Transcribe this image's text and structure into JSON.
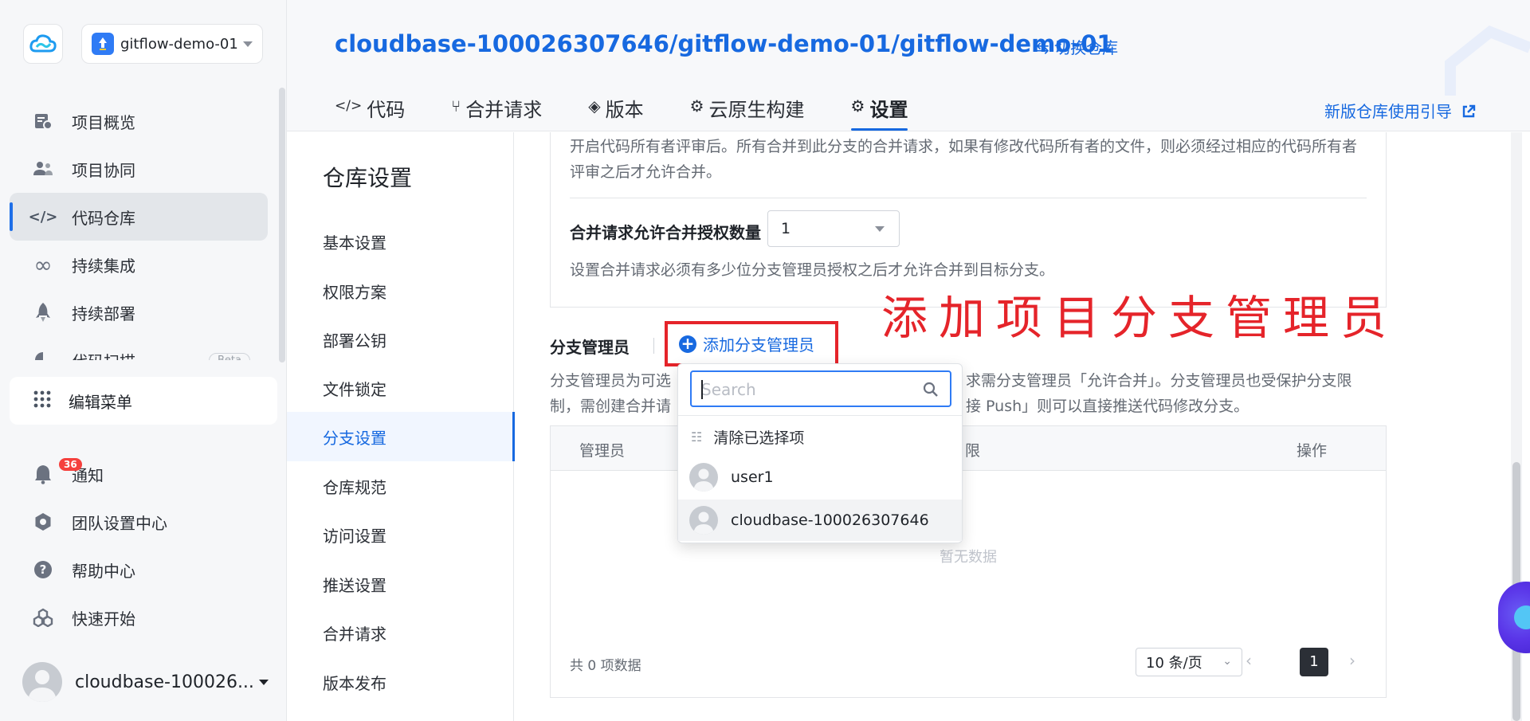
{
  "sidebar": {
    "project_selector": "gitflow-demo-01",
    "items": [
      {
        "label": "项目概览",
        "icon": "dashboard-icon"
      },
      {
        "label": "项目协同",
        "icon": "users-icon"
      },
      {
        "label": "代码仓库",
        "icon": "code-icon",
        "active": true
      },
      {
        "label": "持续集成",
        "icon": "infinity-icon"
      },
      {
        "label": "持续部署",
        "icon": "rocket-icon"
      },
      {
        "label": "代码扫描",
        "icon": "scan-icon",
        "badge": "Beta"
      }
    ],
    "edit_menu": "编辑菜单",
    "bottom_items": [
      {
        "label": "通知",
        "icon": "bell-icon",
        "count": "36"
      },
      {
        "label": "团队设置中心",
        "icon": "settings-icon"
      },
      {
        "label": "帮助中心",
        "icon": "help-icon"
      },
      {
        "label": "快速开始",
        "icon": "cubes-icon"
      }
    ],
    "user_name": "cloudbase-100026..."
  },
  "header": {
    "breadcrumb": "cloudbase-100026307646/gitflow-demo-01/gitflow-demo-01",
    "switch_repo": "⇆ 切换仓库",
    "tabs": [
      {
        "label": "代码",
        "icon": "</>"
      },
      {
        "label": "合并请求",
        "icon": "⑂"
      },
      {
        "label": "版本",
        "icon": "◈"
      },
      {
        "label": "云原生构建",
        "icon": "⚙"
      },
      {
        "label": "设置",
        "icon": "⚙",
        "active": true
      }
    ],
    "guide_link": "新版仓库使用引导"
  },
  "subnav": {
    "title": "仓库设置",
    "items": [
      "基本设置",
      "权限方案",
      "部署公钥",
      "文件锁定",
      "分支设置",
      "仓库规范",
      "访问设置",
      "推送设置",
      "合并请求",
      "版本发布"
    ],
    "active_index": 4
  },
  "main": {
    "code_owner_desc": "开启代码所有者评审后。所有合并到此分支的合并请求，如果有修改代码所有者的文件，则必须经过相应的代码所有者评审之后才允许合并。",
    "merge_auth_label": "合并请求允许合并授权数量",
    "merge_auth_value": "1",
    "merge_auth_hint": "设置合并请求必须有多少位分支管理员授权之后才允许合并到目标分支。",
    "branch_admin_title": "分支管理员",
    "add_admin_button": "添加分支管理员",
    "annotation": "添加项目分支管理员",
    "desc_l1a": "分支管理员为可选",
    "desc_l1b": "求需分支管理员「允许合并」。分支管理员也受保护分支限",
    "desc_l2a": "制，需创建合并请",
    "desc_l2b": "接 Push」则可以直接推送代码修改分支。",
    "table": {
      "columns": [
        "管理员",
        "限",
        "操作"
      ],
      "empty_text": "暂无数据",
      "total": "共 0 项数据",
      "page_size": "10 条/页",
      "current_page": "1"
    }
  },
  "dropdown": {
    "search_placeholder": "Search",
    "clear_label": "清除已选择项",
    "options": [
      "user1",
      "cloudbase-100026307646"
    ]
  }
}
